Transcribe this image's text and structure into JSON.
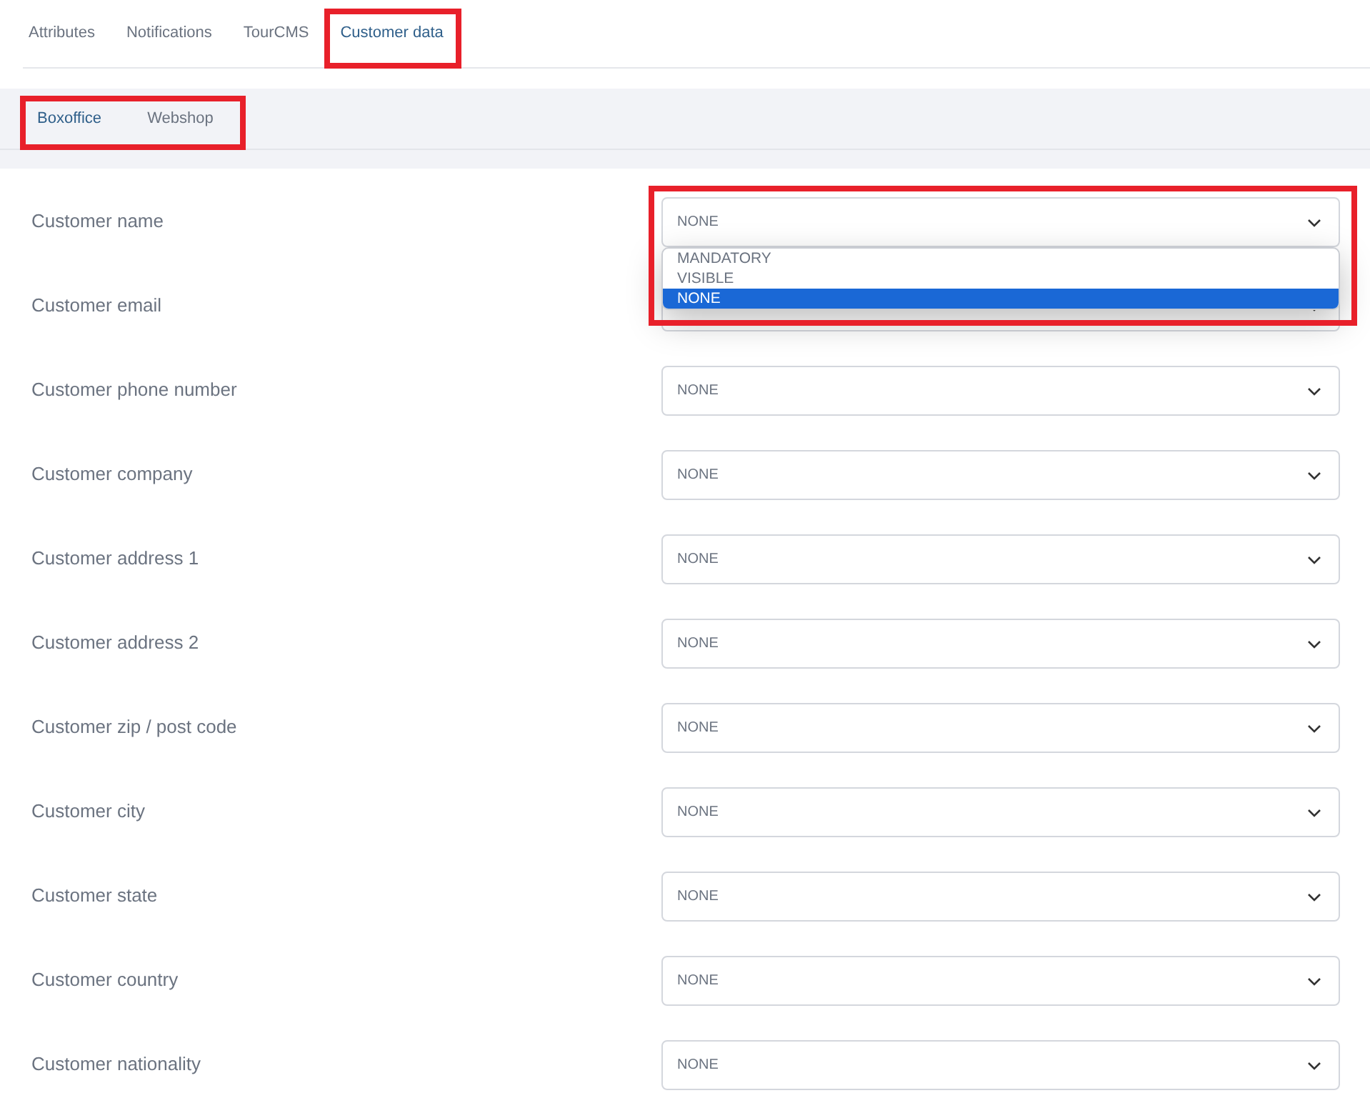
{
  "tabs": [
    {
      "label": "Attributes",
      "selected": false,
      "highlighted": false
    },
    {
      "label": "Notifications",
      "selected": false,
      "highlighted": false
    },
    {
      "label": "TourCMS",
      "selected": false,
      "highlighted": false
    },
    {
      "label": "Customer data",
      "selected": true,
      "highlighted": true
    }
  ],
  "subtabs": {
    "highlighted": true,
    "items": [
      {
        "label": "Boxoffice",
        "selected": true
      },
      {
        "label": "Webshop",
        "selected": false
      }
    ]
  },
  "fields": [
    {
      "label": "Customer name",
      "value": "NONE",
      "highlighted": true,
      "dropdown": {
        "options": [
          {
            "label": "MANDATORY",
            "selected": false
          },
          {
            "label": "VISIBLE",
            "selected": false
          },
          {
            "label": "NONE",
            "selected": true
          }
        ]
      }
    },
    {
      "label": "Customer email",
      "highlighted": false
    },
    {
      "label": "Customer phone number",
      "value": "NONE",
      "highlighted": false
    },
    {
      "label": "Customer company",
      "value": "NONE",
      "highlighted": false
    },
    {
      "label": "Customer address 1",
      "value": "NONE",
      "highlighted": false
    },
    {
      "label": "Customer address 2",
      "value": "NONE",
      "highlighted": false
    },
    {
      "label": "Customer zip / post code",
      "value": "NONE",
      "highlighted": false
    },
    {
      "label": "Customer city",
      "value": "NONE",
      "highlighted": false
    },
    {
      "label": "Customer state",
      "value": "NONE",
      "highlighted": false
    },
    {
      "label": "Customer country",
      "value": "NONE",
      "highlighted": false
    },
    {
      "label": "Customer nationality",
      "value": "NONE",
      "highlighted": false
    }
  ]
}
